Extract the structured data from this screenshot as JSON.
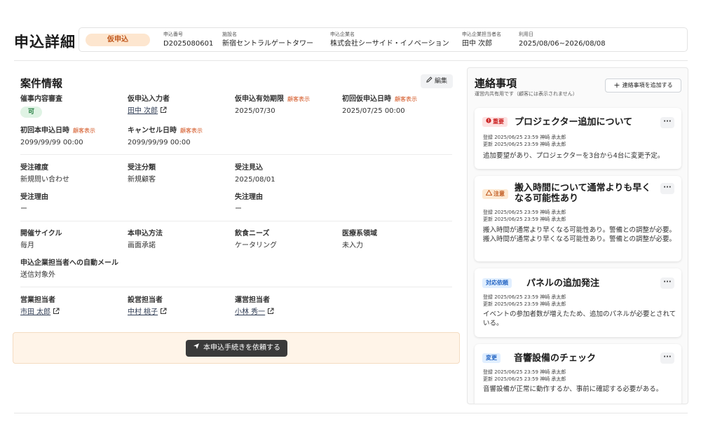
{
  "header": {
    "title": "申込詳細",
    "status": "仮申込",
    "items": [
      {
        "label": "申込番号",
        "value": "D2025080601"
      },
      {
        "label": "施設名",
        "value": "新宿セントラルゲートタワー"
      },
      {
        "label": "申込企業名",
        "value": "株式会社シーサイド・イノベーション"
      },
      {
        "label": "申込企業担当者名",
        "value": "田中 次郎"
      },
      {
        "label": "利用日",
        "value": "2025/08/06~2026/08/08"
      }
    ]
  },
  "case_info": {
    "title": "案件情報",
    "edit_label": "編集",
    "customer_tag": "顧客表示",
    "fields": {
      "review": {
        "label": "催事内容審査",
        "value": "可"
      },
      "prov_entrant": {
        "label": "仮申込入力者",
        "value": "田中 次郎"
      },
      "prov_expiry": {
        "label": "仮申込有効期限",
        "value": "2025/07/30"
      },
      "first_prov_date": {
        "label": "初回仮申込日時",
        "value": "2025/07/25 00:00"
      },
      "first_main_date": {
        "label": "初回本申込日時",
        "value": "2099/99/99 00:00"
      },
      "cancel_date": {
        "label": "キャンセル日時",
        "value": "2099/99/99 00:00"
      },
      "order_certainty": {
        "label": "受注確度",
        "value": "新規問い合わせ"
      },
      "order_category": {
        "label": "受注分類",
        "value": "新規顧客"
      },
      "order_forecast": {
        "label": "受注見込",
        "value": "2025/08/01"
      },
      "order_reason": {
        "label": "受注理由",
        "value": "ー"
      },
      "lost_reason": {
        "label": "失注理由",
        "value": "ー"
      },
      "cycle": {
        "label": "開催サイクル",
        "value": "毎月"
      },
      "main_method": {
        "label": "本申込方法",
        "value": "画面承諾"
      },
      "food_needs": {
        "label": "飲食ニーズ",
        "value": "ケータリング"
      },
      "medical": {
        "label": "医療系領域",
        "value": "未入力"
      },
      "auto_mail": {
        "label": "申込企業担当者への自動メール",
        "value": "送信対象外"
      },
      "sales_rep": {
        "label": "営業担当者",
        "value": "市田 太郎"
      },
      "setup_rep": {
        "label": "設営担当者",
        "value": "中村 桃子"
      },
      "ops_rep": {
        "label": "運営担当者",
        "value": "小林 秀一"
      }
    },
    "cta_label": "本申込手続きを依頼する"
  },
  "notes": {
    "title": "連絡事項",
    "subtitle": "運営内共有用です（顧客には表示されません）",
    "add_label": "連絡事項を追加する",
    "more_label": "···",
    "cards": [
      {
        "badge": "重要",
        "badge_type": "important",
        "title": "プロジェクター追加について",
        "registered": "登録 2025/06/25 23:59  神崎 承太郎",
        "updated": "更新 2025/06/25 23:59  神崎 承太郎",
        "body": "追加要望があり、プロジェクターを3台から4台に変更予定。"
      },
      {
        "badge": "注意",
        "badge_type": "caution",
        "title": "搬入時間について通常よりも早くなる可能性あり",
        "registered": "登録 2025/06/25 23:59  神崎 承太郎",
        "updated": "更新 2025/06/25 23:59  神崎 承太郎",
        "body": "搬入時間が通常より早くなる可能性あり。警備との調整が必要。搬入時間が通常より早くなる可能性あり。警備との調整が必要。"
      },
      {
        "badge": "対応依頼",
        "badge_type": "request",
        "title": "パネルの追加発注",
        "registered": "登録 2025/06/25 23:59  神崎 承太郎",
        "updated": "更新 2025/06/25 23:59  神崎 承太郎",
        "body": "イベントの参加者数が増えたため、追加のパネルが必要とされている。"
      },
      {
        "badge": "変更",
        "badge_type": "change",
        "title": "音響設備のチェック",
        "registered": "登録 2025/06/25 23:59  神崎 承太郎",
        "updated": "更新 2025/06/25 23:59  神崎 承太郎",
        "body": "音響設備が正常に動作するか、事前に確認する必要がある。"
      }
    ]
  }
}
